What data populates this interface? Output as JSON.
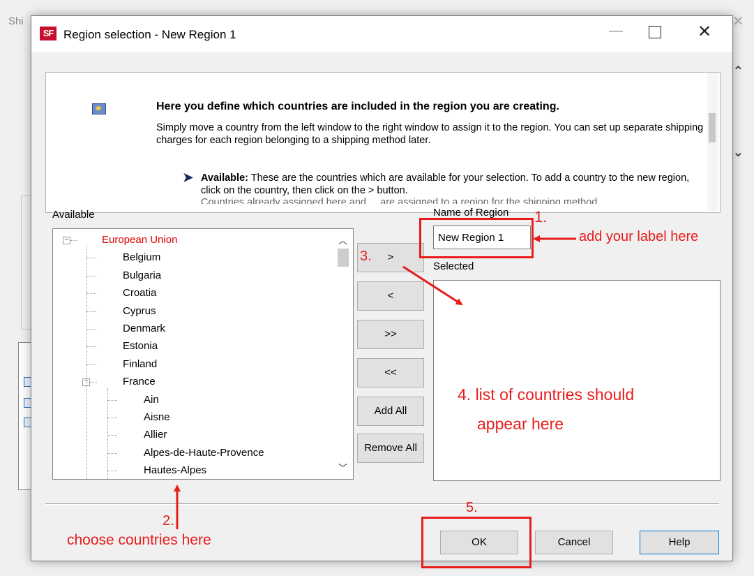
{
  "background_window": {
    "title": "Shi"
  },
  "dialog": {
    "app_icon_text": "SF",
    "title": "Region selection - New Region 1",
    "minimize": "—",
    "close": "✕"
  },
  "info": {
    "heading": "Here you define which countries are included in the region you are creating.",
    "paragraph": "Simply move a country from the left window to the right window to assign it to the region. You can set up separate shipping charges for each region belonging to a shipping method later.",
    "available_bold": "Available:",
    "available_text": " These are the countries which are available for your selection. To add a country to the new region, click on the country, then click on the > button.",
    "cut_line": "Countries already assigned here and ... are assigned to a region for the shipping method."
  },
  "available": {
    "label": "Available",
    "tree": [
      {
        "label": "European Union",
        "level": 0,
        "expanded": true
      },
      {
        "label": "Belgium",
        "level": 1
      },
      {
        "label": "Bulgaria",
        "level": 1
      },
      {
        "label": "Croatia",
        "level": 1
      },
      {
        "label": "Cyprus",
        "level": 1
      },
      {
        "label": "Denmark",
        "level": 1
      },
      {
        "label": "Estonia",
        "level": 1
      },
      {
        "label": "Finland",
        "level": 1
      },
      {
        "label": "France",
        "level": 1,
        "expanded": true
      },
      {
        "label": "Ain",
        "level": 2
      },
      {
        "label": "Aisne",
        "level": 2
      },
      {
        "label": "Allier",
        "level": 2
      },
      {
        "label": "Alpes-de-Haute-Provence",
        "level": 2
      },
      {
        "label": "Hautes-Alpes",
        "level": 2
      }
    ]
  },
  "buttons": {
    "move_right": ">",
    "move_left": "<",
    "move_all_right": ">>",
    "move_all_left": "<<",
    "add_all": "Add All",
    "remove_all": "Remove All",
    "ok": "OK",
    "cancel": "Cancel",
    "help": "Help"
  },
  "region": {
    "name_label": "Name of Region",
    "name_value": "New Region 1",
    "selected_label": "Selected"
  },
  "annotations": {
    "step1": "1.",
    "step1_text": "add your label here",
    "step2": "2.",
    "step2_text": "choose countries here",
    "step3": "3.",
    "step4_line1": "4. list of countries should",
    "step4_line2": "appear here",
    "step5": "5."
  },
  "colors": {
    "annotation": "#e81c1c",
    "european_union": "#e00000",
    "help_border": "#0078d7"
  }
}
